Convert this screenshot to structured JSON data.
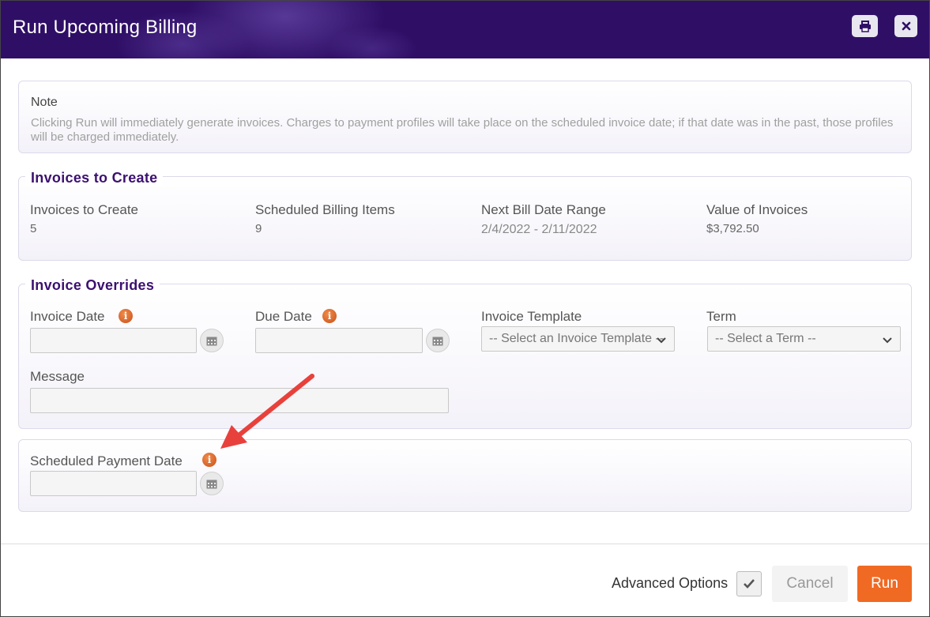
{
  "window": {
    "title": "Run Upcoming Billing",
    "print_icon": "printer-icon",
    "close_icon": "close-icon",
    "header_color": "#2f0f66"
  },
  "note": {
    "title": "Note",
    "text": "Clicking Run will immediately generate invoices. Charges to payment profiles will take place on the scheduled invoice date; if that date was in the past, those profiles will be charged immediately."
  },
  "summary": {
    "title": "Invoices to Create",
    "items": [
      {
        "label": "Invoices to Create",
        "value": "5"
      },
      {
        "label": "Scheduled Billing Items",
        "value": "9"
      },
      {
        "label": "Next Bill Date Range",
        "value": "2/4/2022 - 2/11/2022"
      },
      {
        "label": "Value of Invoices",
        "value": "$3,792.50"
      }
    ]
  },
  "overrides": {
    "title": "Invoice Overrides",
    "invoice_date": {
      "label": "Invoice Date",
      "value": ""
    },
    "due_date": {
      "label": "Due Date",
      "value": ""
    },
    "invoice_template": {
      "label": "Invoice Template",
      "selected": "-- Select an Invoice Template --"
    },
    "term": {
      "label": "Term",
      "selected": "-- Select a Term --"
    },
    "message": {
      "label": "Message",
      "value": ""
    }
  },
  "payment": {
    "scheduled_payment_date": {
      "label": "Scheduled Payment Date",
      "value": ""
    }
  },
  "footer": {
    "advanced_options_label": "Advanced Options",
    "advanced_options_checked": true,
    "cancel_label": "Cancel",
    "run_label": "Run",
    "run_color": "#f06a23"
  },
  "icons": {
    "info": "info-icon",
    "calendar": "calendar-icon",
    "chevron": "chevron-down-icon",
    "check": "check-icon",
    "annotation_arrow_color": "#e8413c"
  }
}
